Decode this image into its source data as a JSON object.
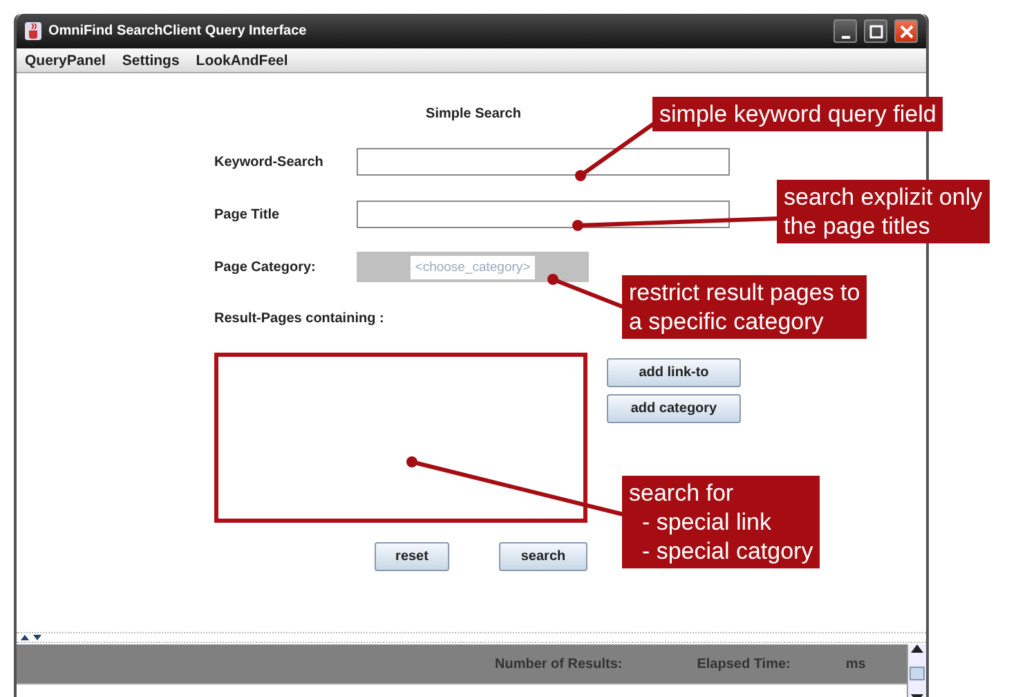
{
  "window": {
    "title": "OmniFind SearchClient Query Interface"
  },
  "menu": [
    "QueryPanel",
    "Settings",
    "LookAndFeel"
  ],
  "form": {
    "heading": "Simple Search",
    "fields": [
      {
        "kind": "text",
        "label": "Keyword-Search"
      },
      {
        "kind": "text",
        "label": "Page Title"
      },
      {
        "kind": "dropdown",
        "label": "Page Category:",
        "value": "<choose_category>",
        "disabled": true
      }
    ],
    "containing_label": "Result-Pages containing :",
    "side_buttons": [
      "add link-to",
      "add category"
    ],
    "buttons": [
      "reset",
      "search"
    ]
  },
  "status_bar": {
    "results_label": "Number of Results:",
    "time_label": "Elapsed Time:",
    "unit": "ms"
  },
  "annotations": [
    {
      "lines": [
        "simple keyword query field"
      ]
    },
    {
      "lines": [
        "search explizit only",
        "the page titles"
      ]
    },
    {
      "lines": [
        "restrict result pages to",
        "a specific category"
      ]
    },
    {
      "lines": [
        "search for",
        "  - special link",
        "  - special catgory"
      ]
    }
  ]
}
